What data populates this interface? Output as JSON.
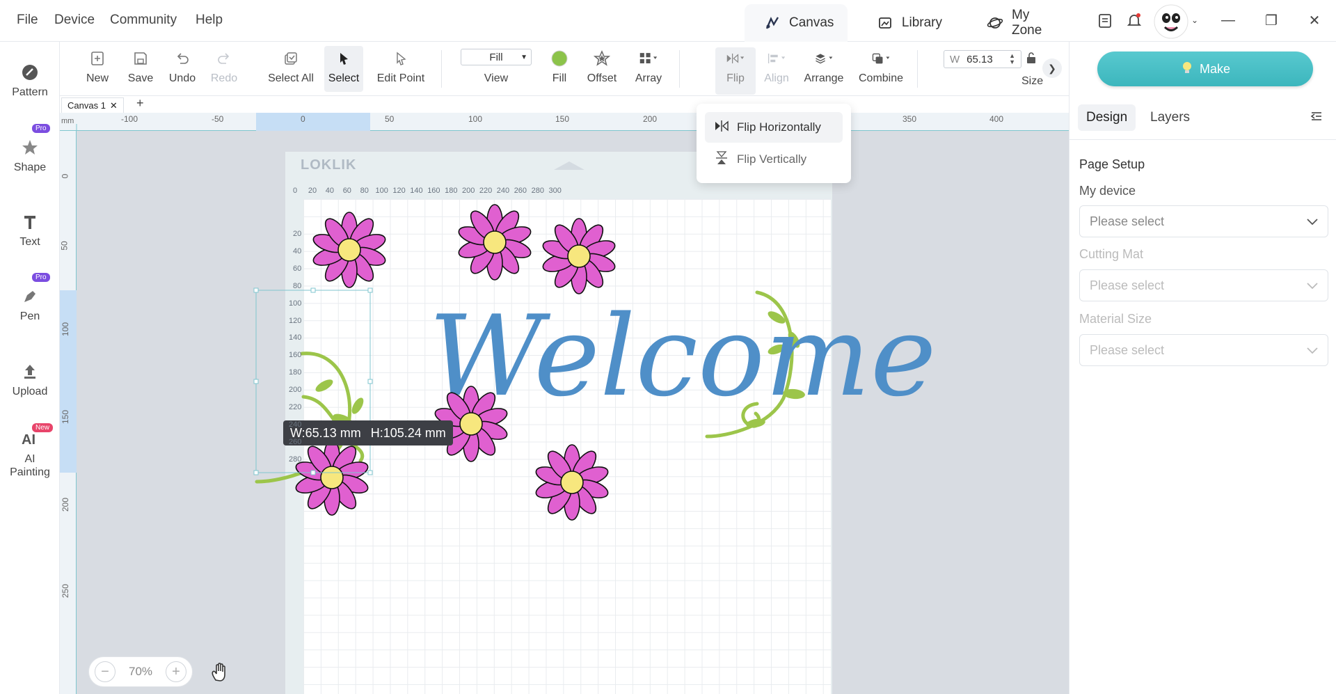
{
  "menu": [
    "File",
    "Device",
    "Community",
    "Help"
  ],
  "top_tabs": [
    {
      "label": "Canvas",
      "icon": "canvas-icon",
      "active": true
    },
    {
      "label": "Library",
      "icon": "library-icon",
      "active": false
    },
    {
      "label": "My Zone",
      "icon": "myzone-icon",
      "active": false
    }
  ],
  "sidebar": [
    {
      "label": "Pattern",
      "icon": "pattern-icon",
      "badge": ""
    },
    {
      "label": "Shape",
      "icon": "star-icon",
      "badge": "Pro"
    },
    {
      "label": "Text",
      "icon": "text-icon",
      "badge": ""
    },
    {
      "label": "Pen",
      "icon": "pen-icon",
      "badge": "Pro"
    },
    {
      "label": "Upload",
      "icon": "upload-icon",
      "badge": ""
    },
    {
      "label": "AI Painting",
      "icon": "ai-icon",
      "badge": "New"
    }
  ],
  "toolbar": {
    "new": "New",
    "save": "Save",
    "undo": "Undo",
    "redo": "Redo",
    "select_all": "Select All",
    "select": "Select",
    "edit_point": "Edit Point",
    "view_value": "Fill",
    "view_label": "View",
    "fill": "Fill",
    "offset": "Offset",
    "array": "Array",
    "flip": "Flip",
    "align": "Align",
    "arrange": "Arrange",
    "combine": "Combine",
    "w_label": "W",
    "w_value": "65.13",
    "size": "Size"
  },
  "doc_tab": "Canvas 1",
  "ruler": {
    "unit": "mm",
    "h_labels": [
      "-100",
      "-50",
      "0",
      "50",
      "100",
      "150",
      "200",
      "350",
      "400"
    ],
    "v_labels": [
      "0",
      "50",
      "100",
      "150",
      "200",
      "250"
    ],
    "mat_h": [
      "0",
      "20",
      "40",
      "60",
      "80",
      "100",
      "120",
      "140",
      "160",
      "180",
      "200",
      "220",
      "240",
      "260",
      "280",
      "300"
    ],
    "mat_v": [
      "20",
      "40",
      "60",
      "80",
      "100",
      "120",
      "140",
      "160",
      "180",
      "200",
      "220",
      "240",
      "260",
      "280"
    ]
  },
  "mat_brand": "LOKLIK",
  "flip_menu": {
    "horizontal": "Flip Horizontally",
    "vertical": "Flip Vertically"
  },
  "size_tooltip": {
    "w": "W:65.13 mm",
    "h": "H:105.24 mm"
  },
  "canvas_text": "Welcome",
  "zoom": "70%",
  "right_panel": {
    "make": "Make",
    "tabs": [
      "Design",
      "Layers"
    ],
    "page_setup": "Page Setup",
    "my_device": "My device",
    "cutting_mat": "Cutting Mat",
    "material_size": "Material Size",
    "placeholder": "Please select"
  },
  "colors": {
    "accent": "#4fc1c7",
    "petal": "#e060d0",
    "center": "#f7e77e",
    "welcome": "#4f8fc8",
    "vine": "#9cc54a",
    "fill_dot": "#8cc34a"
  }
}
